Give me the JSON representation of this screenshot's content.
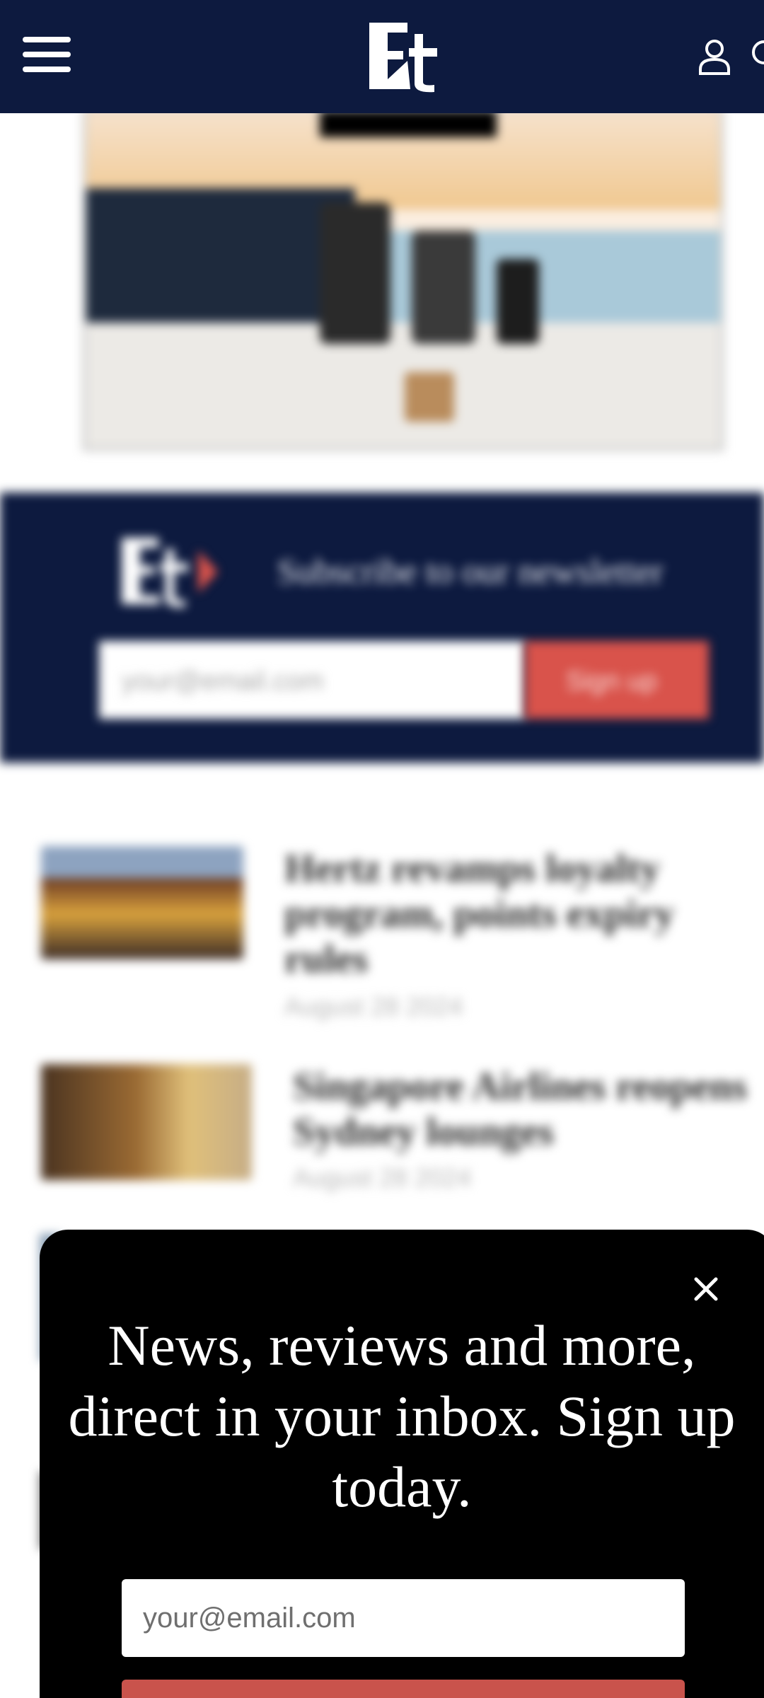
{
  "header": {
    "logo_text": "Et",
    "colors": {
      "navy": "#0d1a3f",
      "accent": "#d9534b"
    },
    "icons": [
      "menu-icon",
      "user-icon",
      "search-icon"
    ]
  },
  "background_content": {
    "newsletter": {
      "text": "Subscribe to our newsletter",
      "email_placeholder": "your@email.com",
      "button_label": "Sign up"
    },
    "articles": [
      {
        "title": "Hertz revamps loyalty program, points expiry rules",
        "date": "August 28 2024"
      },
      {
        "title": "Singapore Airlines reopens Sydney lounges",
        "date": "August 28 2024"
      }
    ]
  },
  "modal": {
    "title": "News, reviews and more, direct in your inbox. Sign up today.",
    "email_placeholder": "your@email.com"
  }
}
